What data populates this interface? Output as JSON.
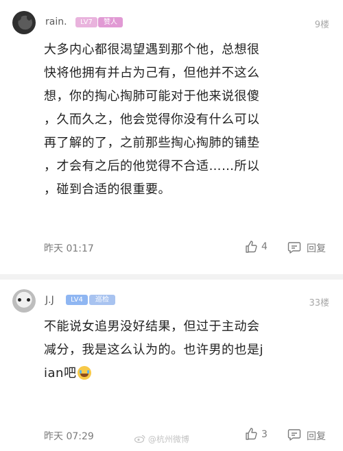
{
  "comments": [
    {
      "username": "rain.",
      "level": "LV7",
      "role": "赞人",
      "floor": "9楼",
      "lines": [
        "大多内心都很渴望遇到那个他，总想很",
        "快将他拥有并占为己有，但他并不这么",
        "想，你的掏心掏肺可能对于他来说很傻",
        "，久而久之，他会觉得你没有什么可以",
        "再了解的了，之前那些掏心掏肺的铺垫",
        "，才会有之后的他觉得不合适……所以",
        "，碰到合适的很重要。"
      ],
      "time": "昨天 01:17",
      "likes": "4",
      "reply": "回复"
    },
    {
      "username": "J.J",
      "level": "LV4",
      "role": "巡检",
      "floor": "33楼",
      "lines": [
        "不能说女追男没好结果，但过于主动会",
        "减分，我是这么认为的。也许男的也是j",
        "ian吧"
      ],
      "emoji": "laughing-tears-emoji",
      "time": "昨天 07:29",
      "likes": "3",
      "reply": "回复"
    }
  ],
  "watermark": "@杭州微博"
}
